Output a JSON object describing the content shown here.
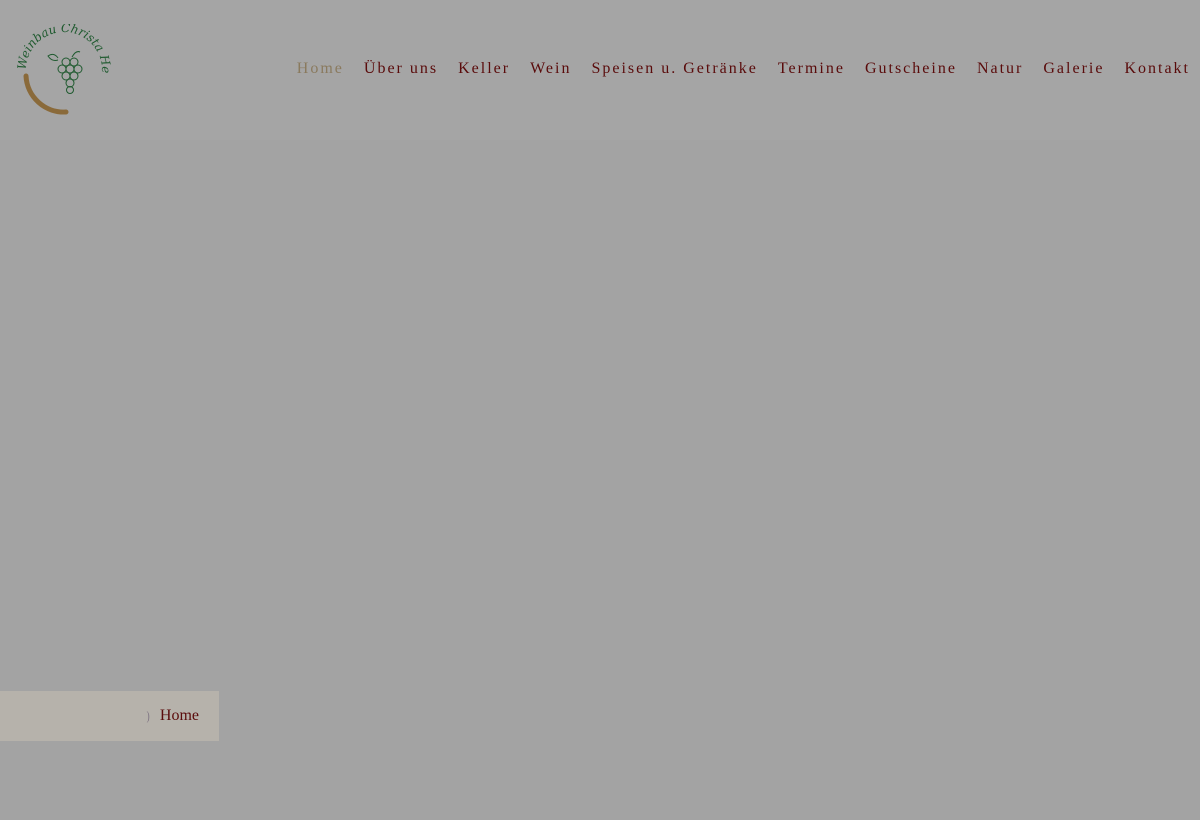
{
  "brand": {
    "logo_text": "Weinbau Christa Herzog",
    "colors": {
      "logo_green": "#1f5a2f",
      "logo_arc": "#8a6a3a"
    }
  },
  "nav": {
    "items": [
      {
        "label": "Home",
        "active": true
      },
      {
        "label": "Über uns"
      },
      {
        "label": "Keller"
      },
      {
        "label": "Wein"
      },
      {
        "label": "Speisen u. Getränke"
      },
      {
        "label": "Termine"
      },
      {
        "label": "Gutscheine"
      },
      {
        "label": "Natur"
      },
      {
        "label": "Galerie"
      },
      {
        "label": "Kontakt"
      }
    ],
    "colors": {
      "link": "#5a0b0b",
      "active": "#8a7a5e"
    }
  },
  "breadcrumb": {
    "separator": ")",
    "current": "Home"
  }
}
